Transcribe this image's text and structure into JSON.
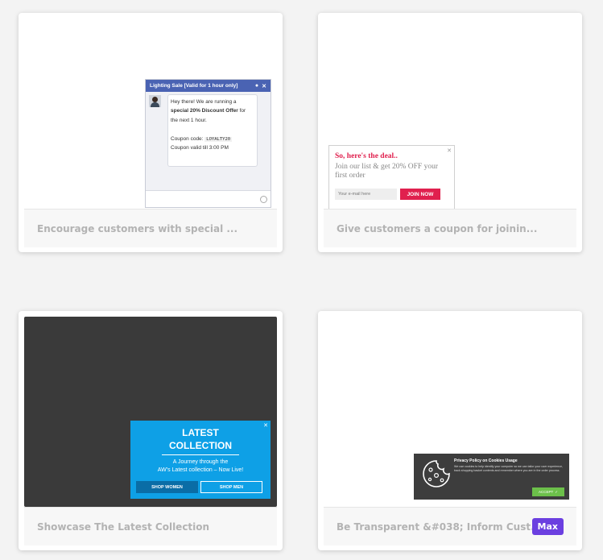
{
  "cards": [
    {
      "caption": "Encourage customers with special ...",
      "chat": {
        "header": "Lighting Sale [Valid for 1 hour only]",
        "line1": "Hey there! We are running a",
        "bold": "special 20% Discount Offer",
        "line2": "for the next 1 hour.",
        "code_label": "Coupon code:",
        "code": "LOYALTY20",
        "valid": "Coupon valid till 3:00 PM"
      }
    },
    {
      "caption": "Give customers a coupon for joinin...",
      "deal": {
        "title": "So, here's the deal..",
        "sub": "Join our list & get 20% OFF your first order",
        "placeholder": "Your e-mail here",
        "button": "JOIN NOW"
      }
    },
    {
      "caption": "Showcase The Latest Collection",
      "latest": {
        "title_line1": "LATEST",
        "title_line2": "COLLECTION",
        "sub_line1": "A Journey through the",
        "sub_line2": "AW's Latest collection – Now Live!",
        "btn_women": "SHOP WOMEN",
        "btn_men": "SHOP MEN"
      }
    },
    {
      "caption": "Be Transparent &#038; Inform Cust...",
      "badge": "Max",
      "cookie": {
        "title": "Privacy Policy on Cookies Usage",
        "text": "We use cookies to help identify your computer so we can tailor your user experience, track shopping basket contents and remember where you are in the order process.",
        "button": "ACCEPT"
      }
    }
  ],
  "colors": {
    "badge": "#6b3fe0",
    "deal_accent": "#e0204e",
    "latest_bg": "#0ea0e6",
    "chat_header": "#4a63b3"
  }
}
